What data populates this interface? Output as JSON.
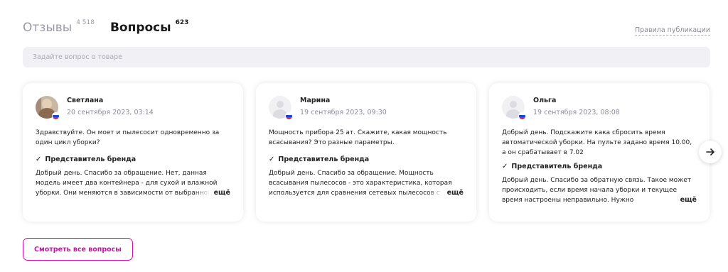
{
  "tabs": [
    {
      "label": "Отзывы",
      "count": "4 518",
      "active": false
    },
    {
      "label": "Вопросы",
      "count": "623",
      "active": true
    }
  ],
  "rules_link": "Правила публикации",
  "ask_input": {
    "placeholder": "Задайте вопрос о товаре",
    "value": ""
  },
  "cards": [
    {
      "name": "Светлана",
      "date": "20 сентября 2023, 03:14",
      "question": "Здравствуйте. Он моет и пылесосит одновременно за один цикл уборки?",
      "brand_label": "Представитель бренда",
      "answer": "Добрый день. Спасибо за обращение. Нет, данная модель имеет два контейнера - для сухой и влажной уборки. Они меняются в зависимости от выбранного",
      "more": "ещё",
      "avatar": "photo"
    },
    {
      "name": "Марина",
      "date": "19 сентября 2023, 09:30",
      "question": "Мощность прибора 25 ат. Скажите, какая мощность всасывания? Это разные параметры.",
      "brand_label": "Представитель бренда",
      "answer": "Добрый день. Спасибо за обращение. Мощность всасывания пылесосов - это характеристика, которая используется для сравнения сетевых пылесосов с",
      "more": "ещё",
      "avatar": "empty"
    },
    {
      "name": "Ольга",
      "date": "19 сентября 2023, 08:08",
      "question": "Добрый день. Подскажите кака сбросить время автоматической уборки. На пульте задано время 10.00, а он срабатывает в 7.02",
      "brand_label": "Представитель бренда",
      "answer": "Добрый день. Спасибо за обратную связь. Такое может происходить, если время начала уборки и текущее время настроены неправильно. Нужно",
      "more": "ещё",
      "avatar": "empty"
    }
  ],
  "next_icon": "arrow-right-icon",
  "check_icon": "check-icon",
  "view_all_button": "Смотреть все вопросы",
  "colors": {
    "accent": "#cb11ab",
    "field_bg": "#f1f1f5",
    "muted": "#9a9aa6"
  }
}
